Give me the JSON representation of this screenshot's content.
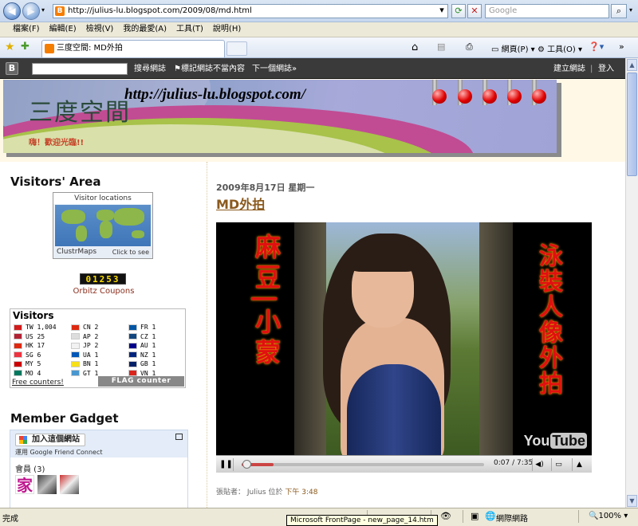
{
  "browser": {
    "address": "http://julius-lu.blogspot.com/2009/08/md.html",
    "search_placeholder": "Google",
    "menu": [
      "檔案(F)",
      "編輯(E)",
      "檢視(V)",
      "我的最愛(A)",
      "工具(T)",
      "說明(H)"
    ],
    "tab_title": "三度空間: MD外拍",
    "toolbar": {
      "page": "網頁(P)",
      "tools": "工具(O)"
    },
    "status_text": "完成",
    "zone": "網際網路",
    "zoom": "100%",
    "tooltip": "Microsoft FrontPage - new_page_14.htm"
  },
  "navbar": {
    "search_button": "搜尋網誌",
    "flag": "標記網誌不當內容",
    "next": "下一個網誌»",
    "create": "建立網誌",
    "login": "登入"
  },
  "header": {
    "title": "三度空間",
    "url": "http://julius-lu.blogspot.com/",
    "welcome": "嗨！歡迎光臨!!"
  },
  "sidebar": {
    "visitors_area_title": "Visitors' Area",
    "map_caption": "Visitor locations",
    "map_footer": "ClustrMaps",
    "map_click": "Click to see",
    "counter": "01253",
    "orbitz": "Orbitz Coupons",
    "flag_title": "Visitors",
    "flags": [
      [
        {
          "code": "TW",
          "count": "1,004",
          "color": "#d31a1a"
        },
        {
          "code": "US",
          "count": "25",
          "color": "#b22234"
        },
        {
          "code": "HK",
          "count": "17",
          "color": "#de2910"
        },
        {
          "code": "SG",
          "count": "6",
          "color": "#ef3340"
        },
        {
          "code": "MY",
          "count": "5",
          "color": "#cc0001"
        },
        {
          "code": "MO",
          "count": "4",
          "color": "#00785e"
        }
      ],
      [
        {
          "code": "CN",
          "count": "2",
          "color": "#de2910"
        },
        {
          "code": "AP",
          "count": "2",
          "color": "#dddddd"
        },
        {
          "code": "JP",
          "count": "2",
          "color": "#f2f2f2"
        },
        {
          "code": "UA",
          "count": "1",
          "color": "#0057b7"
        },
        {
          "code": "BN",
          "count": "1",
          "color": "#f7e017"
        },
        {
          "code": "GT",
          "count": "1",
          "color": "#4997d0"
        }
      ],
      [
        {
          "code": "FR",
          "count": "1",
          "color": "#0055a4"
        },
        {
          "code": "CZ",
          "count": "1",
          "color": "#11457e"
        },
        {
          "code": "AU",
          "count": "1",
          "color": "#00008b"
        },
        {
          "code": "NZ",
          "count": "1",
          "color": "#00247d"
        },
        {
          "code": "GB",
          "count": "1",
          "color": "#012169"
        },
        {
          "code": "VN",
          "count": "1",
          "color": "#da251d"
        }
      ]
    ],
    "flag_footer": "Free counters!",
    "flag_counter": "FLAG counter",
    "member_title": "Member Gadget",
    "join": "加入這個網站",
    "gfc": "運用 Google Friend Connect",
    "members": "會員 (3)"
  },
  "post": {
    "date": "2009年8月17日 星期一",
    "title": "MD外拍",
    "video": {
      "left_text": "麻豆|小蒙",
      "right_text": "泳裝人像外拍",
      "logo_you": "You",
      "logo_tube": "Tube",
      "time": "0:07 / 7:35",
      "progress": 0.015
    },
    "footer_prefix": "張貼者： Julius 位於",
    "footer_time": "下午 3:48"
  }
}
